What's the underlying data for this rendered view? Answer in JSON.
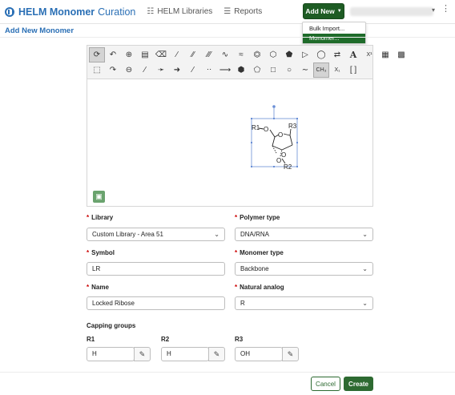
{
  "nav": {
    "brand_title": "HELM Monomer",
    "brand_subtitle": "Curation",
    "links": [
      {
        "label": "HELM Libraries",
        "icon": "library-icon"
      },
      {
        "label": "Reports",
        "icon": "list-icon"
      }
    ],
    "add_new_label": "Add New",
    "add_new_menu": [
      "Bulk Import...",
      "Monomer..."
    ]
  },
  "page": {
    "title": "Add New Monomer"
  },
  "editor": {
    "toolbar_row1": [
      "lasso-icon",
      "undo-icon",
      "zoom-in-icon",
      "paste-icon",
      "eraser-icon",
      "single-bond-icon",
      "double-bond-icon",
      "triple-bond-icon",
      "chain-icon",
      "chain-wavy-icon",
      "benzene-icon",
      "hexagon-icon",
      "pentagon-icon",
      "triangle-icon",
      "circle-icon",
      "arrow-icon",
      "atom-text-icon",
      "superscript-icon",
      "rgroup-icon",
      "rgroup-attachment-icon"
    ],
    "toolbar_row2": [
      "select-icon",
      "redo-icon",
      "zoom-out-icon",
      "bond-icon",
      "bold-bond-icon",
      "wedge-bond-icon",
      "hash-bond-icon",
      "dash-bond-icon",
      "reaction-arrow-icon",
      "heptagon-icon",
      "pentagon-outline-icon",
      "square-icon",
      "circle-outline-icon",
      "wave-icon",
      "ch3-icon",
      "subscript-icon",
      "bracket-icon"
    ],
    "atom_labels": {
      "r1": "R1",
      "o1": "O",
      "r3": "R3",
      "o_ring": "O",
      "o_minus": "O",
      "o_bottom": "O",
      "r2": "R2"
    }
  },
  "form": {
    "library": {
      "label": "Library",
      "value": "Custom Library - Area 51"
    },
    "polymer_type": {
      "label": "Polymer type",
      "value": "DNA/RNA"
    },
    "symbol": {
      "label": "Symbol",
      "value": "LR"
    },
    "monomer_type": {
      "label": "Monomer type",
      "value": "Backbone"
    },
    "name": {
      "label": "Name",
      "value": "Locked Ribose"
    },
    "natural_analog": {
      "label": "Natural analog",
      "value": "R"
    },
    "capping_groups": {
      "label": "Capping groups",
      "items": [
        {
          "label": "R1",
          "value": "H"
        },
        {
          "label": "R2",
          "value": "H"
        },
        {
          "label": "R3",
          "value": "OH"
        }
      ]
    },
    "cancel_label": "Cancel",
    "create_label": "Create"
  },
  "colors": {
    "brand": "#2a6fb5",
    "primary_green": "#2d6a31",
    "required": "#cc0000"
  }
}
